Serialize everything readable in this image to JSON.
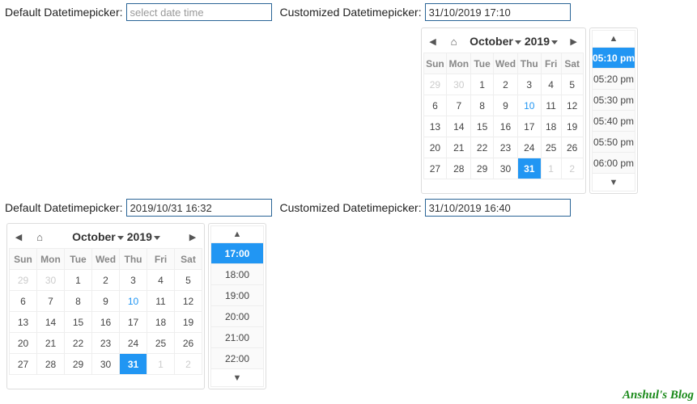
{
  "watermark": "Anshul's Blog",
  "row1": {
    "default": {
      "label": "Default Datetimepicker:",
      "placeholder": "select date time",
      "value": ""
    },
    "custom": {
      "label": "Customized Datetimepicker:",
      "value": "31/10/2019 17:10"
    },
    "picker": {
      "month": "October",
      "year": "2019",
      "dow": [
        "Sun",
        "Mon",
        "Tue",
        "Wed",
        "Thu",
        "Fri",
        "Sat"
      ],
      "weeks": [
        [
          {
            "d": "29",
            "o": true
          },
          {
            "d": "30",
            "o": true
          },
          {
            "d": "1"
          },
          {
            "d": "2"
          },
          {
            "d": "3"
          },
          {
            "d": "4"
          },
          {
            "d": "5"
          }
        ],
        [
          {
            "d": "6"
          },
          {
            "d": "7"
          },
          {
            "d": "8"
          },
          {
            "d": "9"
          },
          {
            "d": "10",
            "t": true
          },
          {
            "d": "11"
          },
          {
            "d": "12"
          }
        ],
        [
          {
            "d": "13"
          },
          {
            "d": "14"
          },
          {
            "d": "15"
          },
          {
            "d": "16"
          },
          {
            "d": "17"
          },
          {
            "d": "18"
          },
          {
            "d": "19"
          }
        ],
        [
          {
            "d": "20"
          },
          {
            "d": "21"
          },
          {
            "d": "22"
          },
          {
            "d": "23"
          },
          {
            "d": "24"
          },
          {
            "d": "25"
          },
          {
            "d": "26"
          }
        ],
        [
          {
            "d": "27"
          },
          {
            "d": "28"
          },
          {
            "d": "29"
          },
          {
            "d": "30"
          },
          {
            "d": "31",
            "s": true
          },
          {
            "d": "1",
            "o": true
          },
          {
            "d": "2",
            "o": true
          }
        ]
      ],
      "times": [
        {
          "t": "05:10 pm",
          "s": true
        },
        {
          "t": "05:20 pm"
        },
        {
          "t": "05:30 pm"
        },
        {
          "t": "05:40 pm"
        },
        {
          "t": "05:50 pm"
        },
        {
          "t": "06:00 pm"
        }
      ]
    }
  },
  "row2": {
    "default": {
      "label": "Default Datetimepicker:",
      "value": "2019/10/31 16:32"
    },
    "custom": {
      "label": "Customized Datetimepicker:",
      "value": "31/10/2019 16:40"
    },
    "picker": {
      "month": "October",
      "year": "2019",
      "dow": [
        "Sun",
        "Mon",
        "Tue",
        "Wed",
        "Thu",
        "Fri",
        "Sat"
      ],
      "weeks": [
        [
          {
            "d": "29",
            "o": true
          },
          {
            "d": "30",
            "o": true
          },
          {
            "d": "1"
          },
          {
            "d": "2"
          },
          {
            "d": "3"
          },
          {
            "d": "4"
          },
          {
            "d": "5"
          }
        ],
        [
          {
            "d": "6"
          },
          {
            "d": "7"
          },
          {
            "d": "8"
          },
          {
            "d": "9"
          },
          {
            "d": "10",
            "t": true
          },
          {
            "d": "11"
          },
          {
            "d": "12"
          }
        ],
        [
          {
            "d": "13"
          },
          {
            "d": "14"
          },
          {
            "d": "15"
          },
          {
            "d": "16"
          },
          {
            "d": "17"
          },
          {
            "d": "18"
          },
          {
            "d": "19"
          }
        ],
        [
          {
            "d": "20"
          },
          {
            "d": "21"
          },
          {
            "d": "22"
          },
          {
            "d": "23"
          },
          {
            "d": "24"
          },
          {
            "d": "25"
          },
          {
            "d": "26"
          }
        ],
        [
          {
            "d": "27"
          },
          {
            "d": "28"
          },
          {
            "d": "29"
          },
          {
            "d": "30"
          },
          {
            "d": "31",
            "s": true
          },
          {
            "d": "1",
            "o": true
          },
          {
            "d": "2",
            "o": true
          }
        ]
      ],
      "times": [
        {
          "t": "17:00",
          "s": true
        },
        {
          "t": "18:00"
        },
        {
          "t": "19:00"
        },
        {
          "t": "20:00"
        },
        {
          "t": "21:00"
        },
        {
          "t": "22:00"
        }
      ]
    }
  }
}
